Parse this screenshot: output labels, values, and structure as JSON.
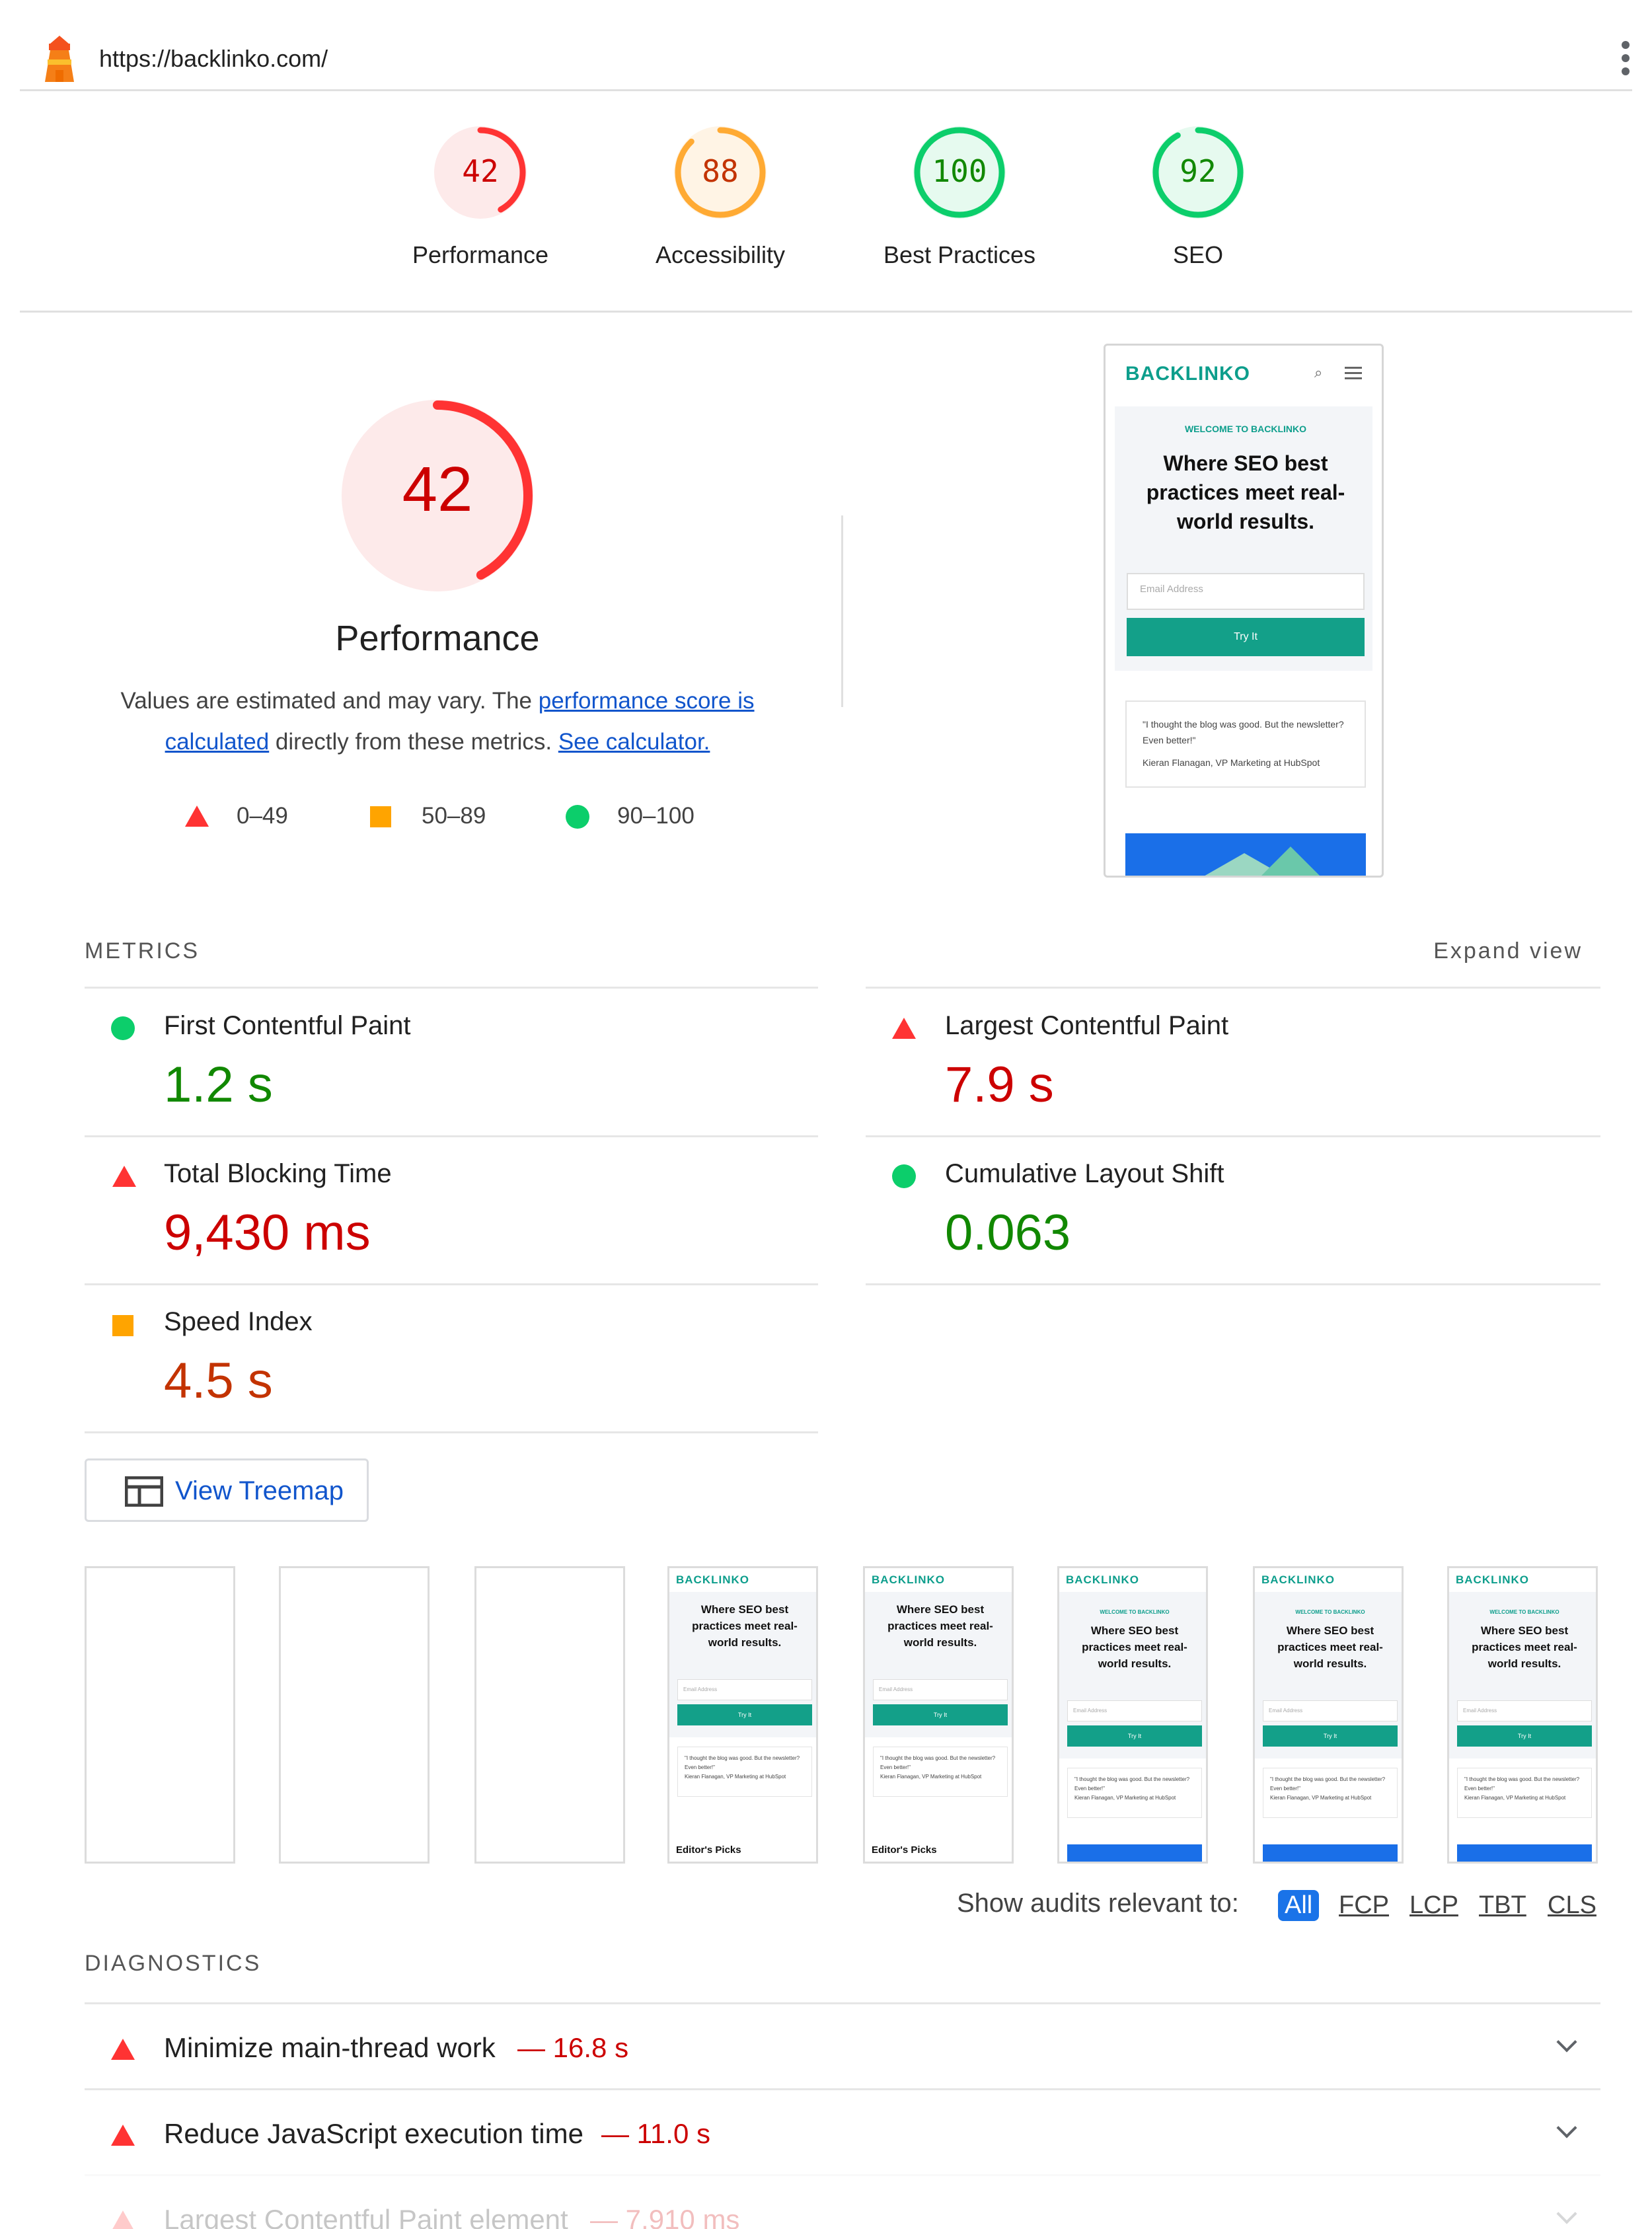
{
  "header": {
    "url": "https://backlinko.com/"
  },
  "summary_gauges": [
    {
      "score": "42",
      "label": "Performance",
      "color": "#ff3333",
      "fill": "#fdeaea",
      "text": "#cc0000",
      "fraction": 0.42
    },
    {
      "score": "88",
      "label": "Accessibility",
      "color": "#ffaa33",
      "fill": "#fff4e5",
      "text": "#c33300",
      "fraction": 0.88
    },
    {
      "score": "100",
      "label": "Best Practices",
      "color": "#0cce6b",
      "fill": "#e6faef",
      "text": "#118800",
      "fraction": 1.0
    },
    {
      "score": "92",
      "label": "SEO",
      "color": "#0cce6b",
      "fill": "#e6faef",
      "text": "#118800",
      "fraction": 0.92
    }
  ],
  "performance": {
    "score": "42",
    "fraction": 0.42,
    "title": "Performance",
    "desc_part1": "Values are estimated and may vary. The ",
    "desc_link1": "performance score is calculated",
    "desc_part2": " directly from these metrics. ",
    "desc_link2": "See calculator.",
    "legend": [
      {
        "shape": "triangle",
        "range": "0–49"
      },
      {
        "shape": "square",
        "range": "50–89"
      },
      {
        "shape": "circle",
        "range": "90–100"
      }
    ]
  },
  "screenshot": {
    "logo": "BACKLINKO",
    "welcome": "WELCOME TO BACKLINKO",
    "headline": "Where SEO best practices meet real-world results.",
    "email_placeholder": "Email Address",
    "button": "Try It",
    "quote": "\"I thought the blog was good. But the newsletter? Even better!\"",
    "quote_author": "Kieran Flanagan, VP Marketing at HubSpot",
    "editors_picks": "Editor's Picks"
  },
  "metrics": {
    "heading": "METRICS",
    "expand": "Expand view",
    "items": [
      {
        "name": "First Contentful Paint",
        "value": "1.2 s",
        "status": "pass"
      },
      {
        "name": "Largest Contentful Paint",
        "value": "7.9 s",
        "status": "fail"
      },
      {
        "name": "Total Blocking Time",
        "value": "9,430 ms",
        "status": "fail"
      },
      {
        "name": "Cumulative Layout Shift",
        "value": "0.063",
        "status": "pass"
      },
      {
        "name": "Speed Index",
        "value": "4.5 s",
        "status": "average"
      }
    ]
  },
  "treemap_button": "View Treemap",
  "filter": {
    "label": "Show audits relevant to:",
    "options": [
      "All",
      "FCP",
      "LCP",
      "TBT",
      "CLS"
    ]
  },
  "diagnostics": {
    "heading": "DIAGNOSTICS",
    "items": [
      {
        "title": "Minimize main-thread work",
        "value": "— 16.8 s"
      },
      {
        "title": "Reduce JavaScript execution time",
        "value": "— 11.0 s"
      },
      {
        "title": "Largest Contentful Paint element",
        "value": "— 7,910 ms"
      }
    ]
  },
  "icons": {
    "lighthouse": "lighthouse-icon",
    "menu": "kebab-menu-icon",
    "treemap": "treemap-icon",
    "expand": "chevron-down-icon"
  }
}
